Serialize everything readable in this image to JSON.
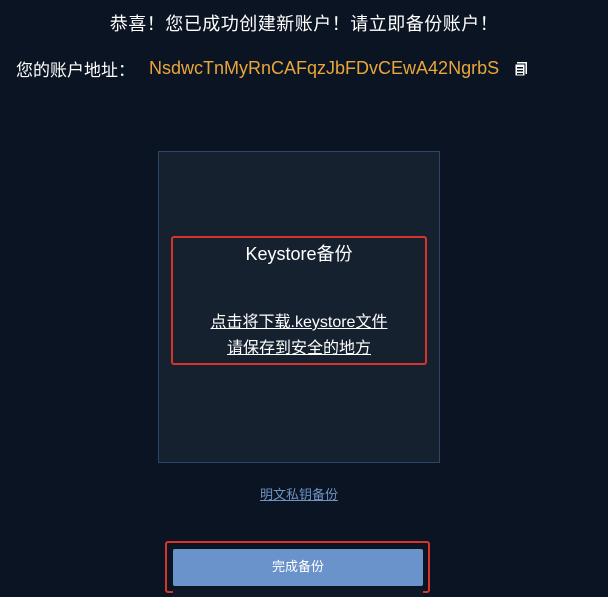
{
  "header": {
    "congrats_text": "恭喜！您已成功创建新账户！请立即备份账户！",
    "address_label": "您的账户地址：",
    "address_value": "NsdwcTnMyRnCAFqzJbFDvCEwA42NgrbS",
    "copy_icon": "copy-icon"
  },
  "keystore": {
    "title": "Keystore备份",
    "download_link": "点击将下载.keystore文件",
    "save_link": "请保存到安全的地方"
  },
  "plain_backup_link": "明文私钥备份",
  "finish_button_label": "完成备份",
  "colors": {
    "background": "#0b1422",
    "address": "#e9a63b",
    "card": "#16212f",
    "highlight": "#d9342b",
    "button": "#6b93cb",
    "link": "#6e93c4"
  }
}
